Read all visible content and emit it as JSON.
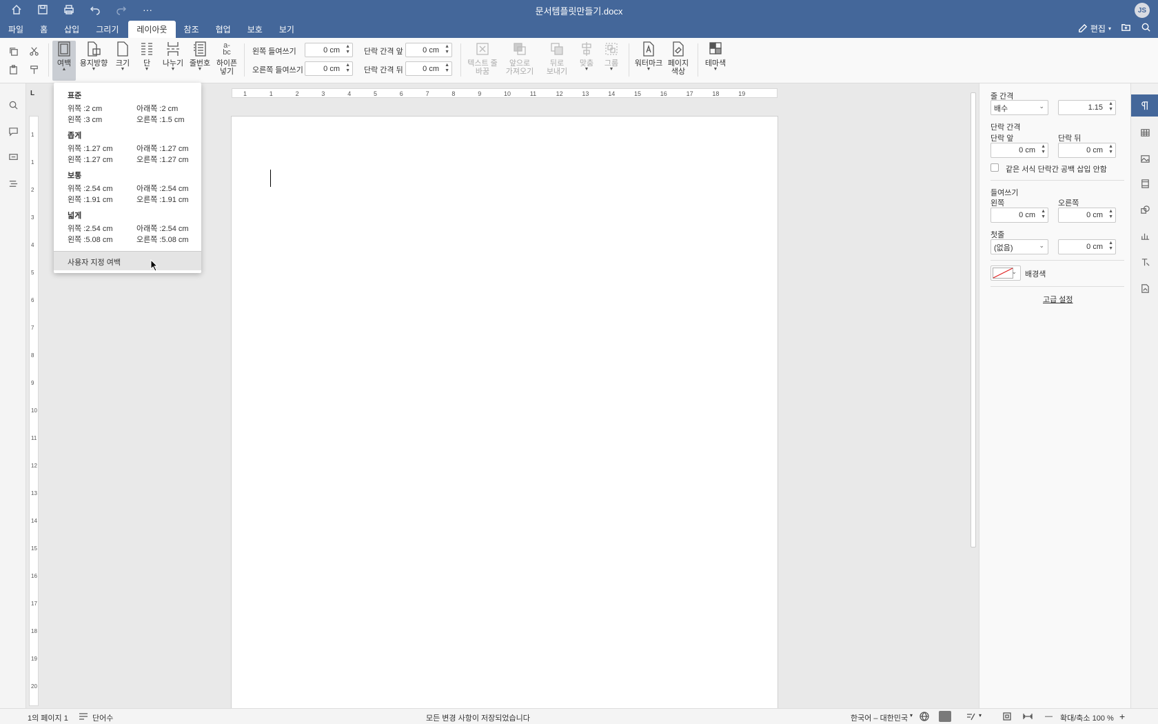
{
  "window": {
    "title": "문서템플릿만들기.docx",
    "avatar": "JS"
  },
  "menu_tabs": [
    "파일",
    "홈",
    "삽입",
    "그리기",
    "레이아웃",
    "참조",
    "협업",
    "보호",
    "보기"
  ],
  "active_tab": "레이아웃",
  "top_right": {
    "edit_label": "편집"
  },
  "ribbon": {
    "margins": "여백",
    "orientation": "용지방향",
    "size": "크기",
    "columns": "단",
    "breaks": "나누기",
    "line_numbers": "줄번호",
    "hyphenation_1": "하이픈",
    "hyphenation_2": "넣기",
    "indent_left_label": "왼쪽 들여쓰기",
    "indent_right_label": "오른쪽 들여쓰기",
    "indent_left_value": "0 cm",
    "indent_right_value": "0 cm",
    "space_before_label": "단락 간격 앞",
    "space_after_label": "단락 간격 뒤",
    "space_before_value": "0 cm",
    "space_after_value": "0 cm",
    "wrap_1": "텍스트 줄",
    "wrap_2": "바꿈",
    "forward_1": "앞으로",
    "forward_2": "가져오기",
    "backward_1": "뒤로",
    "backward_2": "보내기",
    "align": "맞춤",
    "group": "그룹",
    "watermark": "워터마크",
    "page_color_1": "페이지",
    "page_color_2": "색상",
    "theme_color": "테마색"
  },
  "margins_menu": {
    "groups": [
      {
        "name": "표준",
        "top": "위쪽 :2 cm",
        "bottom": "아래쪽 :2 cm",
        "left": "왼쪽 :3 cm",
        "right": "오른쪽 :1.5 cm"
      },
      {
        "name": "좁게",
        "top": "위쪽 :1.27 cm",
        "bottom": "아래쪽 :1.27 cm",
        "left": "왼쪽 :1.27 cm",
        "right": "오른쪽 :1.27 cm"
      },
      {
        "name": "보통",
        "top": "위쪽 :2.54 cm",
        "bottom": "아래쪽 :2.54 cm",
        "left": "왼쪽 :1.91 cm",
        "right": "오른쪽 :1.91 cm"
      },
      {
        "name": "넓게",
        "top": "위쪽 :2.54 cm",
        "bottom": "아래쪽 :2.54 cm",
        "left": "왼쪽 :5.08 cm",
        "right": "오른쪽 :5.08 cm"
      }
    ],
    "custom": "사용자 지정 여백"
  },
  "ruler_numbers": [
    "1",
    "1",
    "2",
    "3",
    "4",
    "5",
    "6",
    "7",
    "8",
    "9",
    "10",
    "11",
    "12",
    "13",
    "14",
    "15",
    "16",
    "17",
    "18",
    "19"
  ],
  "vruler_numbers": [
    "1",
    "1",
    "2",
    "3",
    "4",
    "5",
    "6",
    "7",
    "8",
    "9",
    "10",
    "11",
    "12",
    "13",
    "14",
    "15",
    "16",
    "17",
    "18",
    "19",
    "20"
  ],
  "right_panel": {
    "line_spacing_label": "줄 간격",
    "line_spacing_type": "배수",
    "line_spacing_value": "1.15",
    "para_spacing_label": "단락 간격",
    "before_label": "단락 앞",
    "after_label": "단락 뒤",
    "before_value": "0 cm",
    "after_value": "0 cm",
    "no_space_label": "같은 서식 단락간 공백 삽입 안함",
    "indent_label": "들여쓰기",
    "left_label": "왼쪽",
    "right_label": "오른쪽",
    "left_value": "0 cm",
    "right_value": "0 cm",
    "first_line_label": "첫줄",
    "first_line_type": "(없음)",
    "first_line_value": "0 cm",
    "background_label": "배경색",
    "advanced_label": "고급 설정"
  },
  "status": {
    "page": "1의 페이지 1",
    "words": "단어수",
    "saved": "모든 변경 사항이 저장되었습니다",
    "language": "한국어 – 대한민국",
    "zoom": "확대/축소 100 %"
  },
  "colors": {
    "header_bg": "#44679a",
    "active_icon": "#44679a"
  }
}
